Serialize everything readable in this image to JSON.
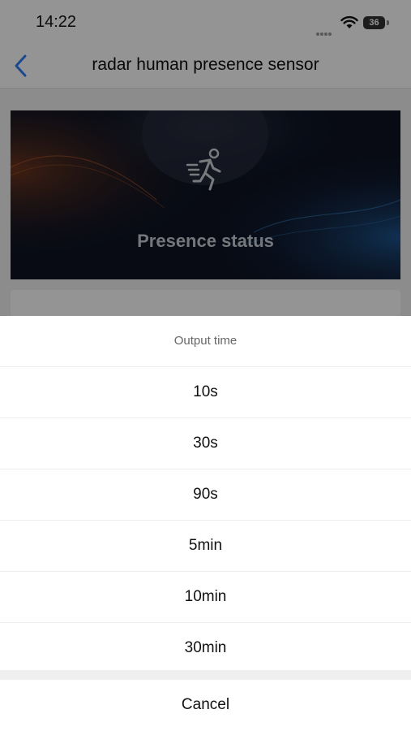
{
  "status_bar": {
    "time": "14:22",
    "battery": "36"
  },
  "nav": {
    "title": "radar human presence sensor",
    "back_icon": "chevron-left-icon"
  },
  "banner": {
    "icon": "running-person-icon",
    "label": "Presence status"
  },
  "sheet": {
    "title": "Output time",
    "options": [
      "10s",
      "30s",
      "90s",
      "5min",
      "10min",
      "30min"
    ],
    "cancel_label": "Cancel"
  },
  "colors": {
    "accent": "#2f7cf6",
    "banner_bg": "#0e1424"
  }
}
